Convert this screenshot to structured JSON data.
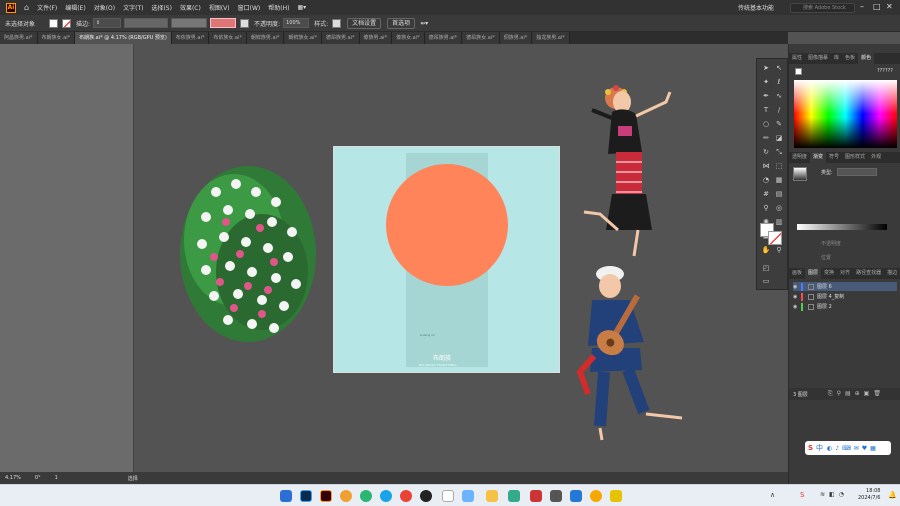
{
  "menubar": {
    "logo": "Ai",
    "items": [
      "文件(F)",
      "编辑(E)",
      "对象(O)",
      "文字(T)",
      "选择(S)",
      "效果(C)",
      "视图(V)",
      "窗口(W)",
      "帮助(H)"
    ],
    "workspace": "传统基本功能",
    "search_placeholder": "搜索 Adobe Stock"
  },
  "control_bar": {
    "selection": "未选择对象",
    "stroke_label": "描边:",
    "opacity_label": "不透明度:",
    "opacity_value": "100%",
    "style_label": "样式:",
    "doc_setup": "文档设置",
    "preferences": "首选项"
  },
  "tabs": [
    {
      "label": "阿昌族男.ai*",
      "active": false
    },
    {
      "label": "布朗族女.ai*",
      "active": false
    },
    {
      "label": "布朗族.ai* @ 4.17% (RGB/GPU 预览)",
      "active": true
    },
    {
      "label": "布依族男.ai*",
      "active": false
    },
    {
      "label": "布依族女.ai*",
      "active": false
    },
    {
      "label": "朝鲜族男.ai*",
      "active": false
    },
    {
      "label": "朝鲜族女.ai*",
      "active": false
    },
    {
      "label": "德昂族男.ai*",
      "active": false
    },
    {
      "label": "傣族男.ai*",
      "active": false
    },
    {
      "label": "傣族女.ai*",
      "active": false
    },
    {
      "label": "德昂族男.ai*",
      "active": false
    },
    {
      "label": "德昂族女.ai*",
      "active": false
    },
    {
      "label": "侗族男.ai*",
      "active": false
    },
    {
      "label": "独龙族男.ai*",
      "active": false
    }
  ],
  "artboard": {
    "small_text": "bulang zu",
    "title": "布朗族",
    "subtitle": "BULANGZU TRADITIONAL"
  },
  "status": {
    "zoom": "4.17%",
    "angle": "0°",
    "page": "1",
    "mode": "选择"
  },
  "color_panel": {
    "tabs": [
      "属性",
      "图像描摹",
      "库",
      "色板",
      "颜色"
    ],
    "active_tab": "颜色",
    "hex": "??????"
  },
  "transparency_panel": {
    "tabs": [
      "透明度",
      "渐变",
      "符号",
      "图形样式",
      "外观"
    ],
    "type_label": "类型:",
    "opacity_label": "不透明度",
    "position_label": "位置"
  },
  "layers_panel": {
    "tabs": [
      "画板",
      "图层",
      "变换",
      "对齐",
      "路径查找器",
      "描边"
    ],
    "layers": [
      {
        "name": "图层 6",
        "color": "#4b7bff"
      },
      {
        "name": "图层 4_复制",
        "color": "#ff4b4b"
      },
      {
        "name": "图层 2",
        "color": "#4bd14b"
      }
    ],
    "count": "3 图层"
  },
  "taskbar": {
    "time": "18:08",
    "date": "2024/7/6"
  },
  "ime": {
    "label": "中"
  },
  "colors": {
    "artboard_bg": "#b7e6e6",
    "sun": "#ff8459",
    "accent_ai": "#ff9a00"
  }
}
